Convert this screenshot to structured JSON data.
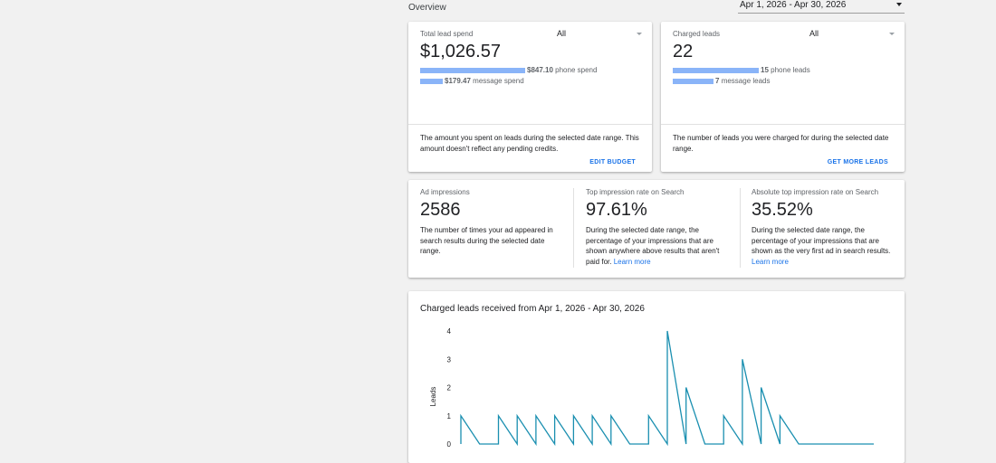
{
  "header": {
    "title": "Overview",
    "date_range": "Apr 1, 2026 - Apr 30, 2026"
  },
  "spend_card": {
    "label": "Total lead spend",
    "filter": "All",
    "value": "$1,026.57",
    "phone_amount": "$847.10",
    "phone_label": "phone spend",
    "phone_fraction": 0.825,
    "message_amount": "$179.47",
    "message_label": "message spend",
    "message_fraction": 0.175,
    "description": "The amount you spent on leads during the selected date range. This amount doesn't reflect any pending credits.",
    "action": "EDIT BUDGET"
  },
  "leads_card": {
    "label": "Charged leads",
    "filter": "All",
    "value": "22",
    "phone_count": "15",
    "phone_label": "phone leads",
    "phone_fraction": 0.68,
    "message_count": "7",
    "message_label": "message leads",
    "message_fraction": 0.32,
    "description": "The number of leads you were charged for during the selected date range.",
    "action": "GET MORE LEADS"
  },
  "impressions": {
    "ad": {
      "label": "Ad impressions",
      "value": "2586",
      "description": "The number of times your ad appeared in search results during the selected date range."
    },
    "top": {
      "label": "Top impression rate on Search",
      "value": "97.61%",
      "description": "During the selected date range, the percentage of your impressions that are shown anywhere above results that aren't paid for.",
      "link": "Learn more"
    },
    "absolute": {
      "label": "Absolute top impression rate on Search",
      "value": "35.52%",
      "description": "During the selected date range, the percentage of your impressions that are shown as the very first ad in search results.",
      "link": "Learn more"
    }
  },
  "chart_section": {
    "title": "Charged leads received from Apr 1, 2026 - Apr 30, 2026"
  },
  "chart_data": {
    "type": "line",
    "ylabel": "Leads",
    "xlabel": "",
    "ylim": [
      0,
      4
    ],
    "yticks": [
      "0",
      "1",
      "2",
      "3",
      "4"
    ],
    "color": "#1a8fb0",
    "x_range": [
      0,
      44
    ],
    "points": [
      [
        0,
        0
      ],
      [
        0,
        1
      ],
      [
        2,
        0
      ],
      [
        4,
        0
      ],
      [
        4,
        1
      ],
      [
        6,
        0
      ],
      [
        6,
        1
      ],
      [
        8,
        0
      ],
      [
        8,
        1
      ],
      [
        10,
        0
      ],
      [
        10,
        1
      ],
      [
        12,
        0
      ],
      [
        12,
        1
      ],
      [
        14,
        0
      ],
      [
        14,
        1
      ],
      [
        16,
        0
      ],
      [
        16,
        1
      ],
      [
        18,
        0
      ],
      [
        20,
        0
      ],
      [
        20,
        1
      ],
      [
        22,
        0
      ],
      [
        22,
        4
      ],
      [
        24,
        0
      ],
      [
        24,
        2
      ],
      [
        26,
        0
      ],
      [
        28,
        0
      ],
      [
        28,
        1
      ],
      [
        30,
        0
      ],
      [
        30,
        3
      ],
      [
        32,
        0
      ],
      [
        32,
        2
      ],
      [
        34,
        0
      ],
      [
        34,
        1
      ],
      [
        36,
        0
      ],
      [
        44,
        0
      ]
    ]
  }
}
